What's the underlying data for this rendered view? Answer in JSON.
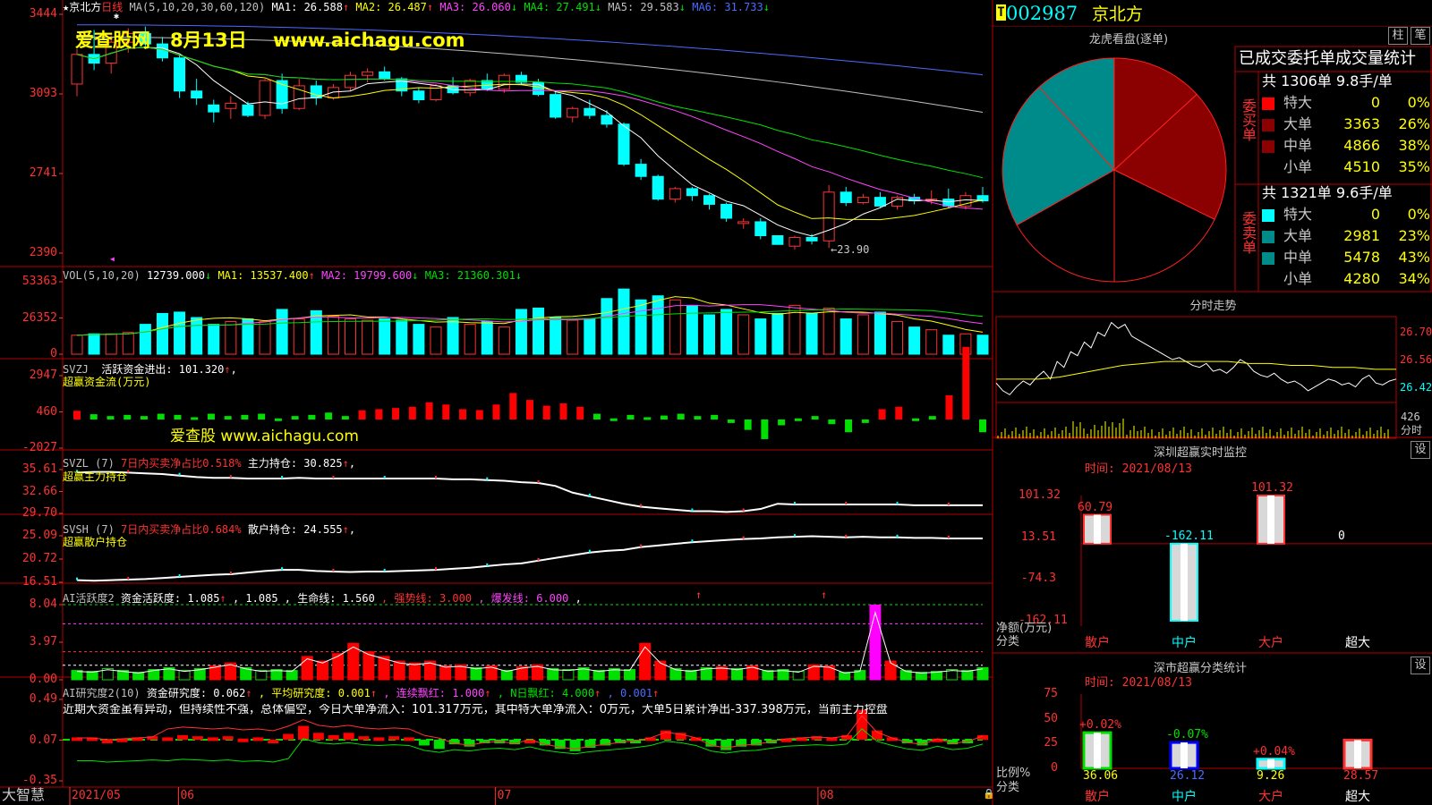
{
  "stock": {
    "code": "002987",
    "name": "京北方",
    "title_name": "京北方",
    "period": "日线",
    "t_badge": "T"
  },
  "ma_line": {
    "prefix": "MA(5,10,20,30,60,120)",
    "items": [
      {
        "label": "MA1: 26.588",
        "arrow": "↑",
        "color": "#ffffff"
      },
      {
        "label": "MA2: 26.487",
        "arrow": "↑",
        "color": "#ffff00"
      },
      {
        "label": "MA3: 26.060",
        "arrow": "↓",
        "color": "#ff44ff"
      },
      {
        "label": "MA4: 27.491",
        "arrow": "↓",
        "color": "#00e000"
      },
      {
        "label": "MA5: 29.583",
        "arrow": "↓",
        "color": "#c0c0c0"
      },
      {
        "label": "MA6: 31.733",
        "arrow": "↓",
        "color": "#4a6cff"
      }
    ]
  },
  "watermark": {
    "site": "爱查股网",
    "date": "8月13日",
    "url": "www.aichagu.com",
    "mid_site": "爱查股",
    "mid_url": "www.aichagu.com"
  },
  "price_axis": [
    "3444",
    "3093",
    "2741",
    "2390"
  ],
  "price_low_label": "←23.90",
  "candles": [
    [
      31.2,
      33.2,
      30.5,
      32.9
    ],
    [
      32.9,
      34.3,
      32.0,
      32.4
    ],
    [
      32.4,
      34.0,
      31.8,
      33.6
    ],
    [
      33.6,
      34.4,
      33.0,
      34.1
    ],
    [
      34.1,
      34.5,
      33.2,
      33.5
    ],
    [
      33.5,
      33.9,
      32.5,
      32.7
    ],
    [
      32.7,
      32.9,
      30.4,
      30.8
    ],
    [
      30.8,
      31.5,
      30.0,
      30.4
    ],
    [
      30.0,
      30.3,
      29.0,
      29.6
    ],
    [
      29.8,
      30.5,
      29.2,
      30.1
    ],
    [
      30.0,
      30.2,
      29.3,
      29.4
    ],
    [
      29.4,
      31.5,
      29.2,
      31.4
    ],
    [
      31.4,
      31.8,
      29.5,
      29.8
    ],
    [
      29.8,
      31.5,
      29.7,
      31.1
    ],
    [
      31.1,
      31.4,
      30.0,
      30.4
    ],
    [
      30.4,
      31.2,
      30.3,
      31.0
    ],
    [
      31.0,
      31.9,
      30.8,
      31.7
    ],
    [
      31.7,
      32.1,
      31.3,
      31.9
    ],
    [
      31.9,
      32.2,
      31.4,
      31.5
    ],
    [
      31.5,
      31.6,
      30.5,
      30.8
    ],
    [
      30.8,
      31.0,
      30.1,
      30.3
    ],
    [
      30.3,
      31.2,
      30.2,
      31.1
    ],
    [
      31.1,
      31.6,
      30.6,
      30.7
    ],
    [
      30.7,
      31.5,
      30.5,
      31.4
    ],
    [
      31.4,
      31.8,
      30.8,
      30.9
    ],
    [
      30.9,
      31.8,
      30.7,
      31.7
    ],
    [
      31.7,
      31.9,
      31.2,
      31.3
    ],
    [
      31.3,
      31.5,
      30.5,
      30.6
    ],
    [
      30.6,
      30.8,
      29.2,
      29.3
    ],
    [
      29.3,
      29.9,
      29.0,
      29.8
    ],
    [
      29.8,
      30.3,
      29.2,
      29.4
    ],
    [
      29.4,
      29.7,
      28.7,
      28.9
    ],
    [
      28.9,
      29.0,
      26.5,
      26.6
    ],
    [
      26.6,
      26.9,
      25.7,
      25.9
    ],
    [
      25.9,
      26.0,
      24.5,
      24.6
    ],
    [
      24.6,
      25.3,
      24.4,
      25.2
    ],
    [
      25.2,
      25.3,
      24.5,
      24.8
    ],
    [
      24.8,
      24.9,
      24.0,
      24.3
    ],
    [
      24.3,
      24.4,
      23.3,
      23.5
    ],
    [
      23.2,
      23.5,
      22.9,
      23.3
    ],
    [
      23.3,
      23.5,
      22.3,
      22.5
    ],
    [
      22.5,
      21.9,
      21.9,
      22.0
    ],
    [
      21.9,
      22.5,
      21.7,
      22.4
    ],
    [
      22.4,
      22.6,
      22.0,
      22.2
    ],
    [
      22.2,
      25.4,
      21.8,
      25.0
    ],
    [
      25.0,
      25.3,
      24.2,
      24.4
    ],
    [
      24.4,
      24.9,
      24.3,
      24.7
    ],
    [
      24.7,
      25.0,
      24.1,
      24.2
    ],
    [
      24.2,
      24.8,
      24.0,
      24.7
    ],
    [
      24.7,
      24.9,
      24.3,
      24.5
    ],
    [
      24.5,
      25.1,
      24.3,
      24.6
    ],
    [
      24.6,
      25.2,
      24.1,
      24.2
    ],
    [
      24.2,
      25.0,
      24.0,
      24.8
    ],
    [
      24.8,
      25.3,
      24.4,
      24.5
    ]
  ],
  "vol_line": {
    "prefix": "VOL(5,10,20)",
    "items": [
      {
        "label": "12739.000",
        "arrow": "↓",
        "color": "#ffffff"
      },
      {
        "label": "MA1: 13537.400",
        "arrow": "↑",
        "color": "#ffff00"
      },
      {
        "label": "MA2: 19799.600",
        "arrow": "↓",
        "color": "#ff44ff"
      },
      {
        "label": "MA3: 21360.301",
        "arrow": "↓",
        "color": "#00e000"
      }
    ],
    "axis": [
      "53363",
      "26352",
      "0"
    ]
  },
  "volumes": [
    14000,
    15000,
    15000,
    16000,
    22000,
    30000,
    31000,
    27000,
    22000,
    24000,
    26000,
    24000,
    33000,
    26000,
    32000,
    28000,
    26000,
    25000,
    26000,
    25000,
    22000,
    20000,
    27000,
    22000,
    24000,
    20000,
    33000,
    34000,
    27000,
    25000,
    26000,
    41000,
    48000,
    40000,
    43000,
    40000,
    36000,
    29000,
    33000,
    29000,
    26000,
    30000,
    36000,
    30000,
    34000,
    26000,
    29000,
    31000,
    24000,
    20000,
    18000,
    14000,
    15000,
    14000
  ],
  "svzj": {
    "prefix": "SVZJ",
    "label": "活跃资金进出: 101.320",
    "arrow": "↑",
    "sub": "超赢资金流(万元)",
    "axis": [
      "2947",
      "460",
      "-2027"
    ]
  },
  "svzj_vals": [
    30,
    -120,
    -200,
    -150,
    -200,
    -100,
    -150,
    -250,
    -100,
    -200,
    -150,
    -100,
    -300,
    -200,
    -150,
    -50,
    -200,
    50,
    100,
    150,
    200,
    400,
    300,
    100,
    60,
    300,
    800,
    500,
    250,
    350,
    200,
    -100,
    -300,
    -150,
    -250,
    -180,
    -100,
    -200,
    -150,
    -500,
    -800,
    -1200,
    -600,
    -300,
    -200,
    -550,
    -900,
    -500,
    100,
    200,
    -300,
    -200,
    700,
    2800,
    -900
  ],
  "svzl": {
    "prefix": "SVZL (7)",
    "ratio": "7日内买卖净占比0.518%",
    "hold": "主力持仓: 30.825",
    "arrow": "↑",
    "sub": "超赢主力持仓",
    "axis": [
      "35.61",
      "32.66",
      "29.70"
    ]
  },
  "svzl_vals": [
    35.2,
    35.3,
    35.3,
    35.2,
    35.1,
    35.0,
    34.8,
    34.6,
    34.5,
    34.5,
    34.4,
    34.4,
    34.4,
    34.5,
    34.4,
    34.4,
    34.4,
    34.4,
    34.4,
    34.4,
    34.4,
    34.4,
    34.3,
    34.3,
    34.2,
    34.1,
    33.9,
    33.8,
    33.4,
    32.5,
    32.0,
    31.5,
    31.0,
    30.6,
    30.4,
    30.2,
    30.0,
    30.0,
    29.9,
    30.0,
    30.3,
    31.0,
    30.9,
    30.9,
    30.9,
    30.9,
    30.9,
    30.9,
    30.9,
    30.8,
    30.8,
    30.8,
    30.8,
    30.8
  ],
  "svsh": {
    "prefix": "SVSH (7)",
    "ratio": "7日内买卖净占比0.684%",
    "hold": "散户持仓: 24.555",
    "arrow": "↑",
    "sub": "超赢散户持仓",
    "axis": [
      "25.09",
      "20.72",
      "16.51"
    ]
  },
  "svsh_vals": [
    16.9,
    16.8,
    16.9,
    17.0,
    17.1,
    17.3,
    17.5,
    17.7,
    17.9,
    18.0,
    18.3,
    18.6,
    18.8,
    18.8,
    18.6,
    18.5,
    18.4,
    18.5,
    18.5,
    18.6,
    18.7,
    18.8,
    19.0,
    19.2,
    19.5,
    19.8,
    20.0,
    20.5,
    21.0,
    21.5,
    22.0,
    22.3,
    22.5,
    23.0,
    23.3,
    23.6,
    23.9,
    24.1,
    24.3,
    24.5,
    24.6,
    24.8,
    24.9,
    25.0,
    24.9,
    24.8,
    24.9,
    24.8,
    24.8,
    24.7,
    24.7,
    24.6,
    24.6,
    24.6
  ],
  "ai_active": {
    "prefix": "AI活跃度2",
    "items": [
      {
        "label": "资金活跃度: 1.085",
        "arrow": "↑",
        "color": "#ffffff"
      },
      {
        "label": ", 1.085",
        "arrow": "",
        "color": "#ffffff"
      },
      {
        "label": ", 生命线: 1.560",
        "arrow": "",
        "color": "#ffffff"
      },
      {
        "label": ", 强势线: 3.000",
        "arrow": "",
        "color": "#ff3232"
      },
      {
        "label": ", 爆发线: 6.000",
        "arrow": "",
        "color": "#ff44ff"
      },
      {
        "label": ",",
        "arrow": "",
        "color": "#ffffff"
      }
    ],
    "axis": [
      "8.04",
      "3.97",
      "0.00"
    ]
  },
  "ai_active_vals": [
    1.0,
    0.9,
    1.2,
    1.0,
    0.8,
    1.1,
    1.3,
    1.0,
    1.2,
    1.5,
    1.8,
    1.3,
    1.0,
    1.1,
    1.0,
    2.5,
    2.0,
    2.8,
    3.9,
    3.0,
    2.5,
    2.0,
    1.8,
    2.0,
    1.5,
    1.6,
    1.3,
    1.5,
    1.0,
    1.4,
    1.6,
    1.2,
    1.1,
    1.3,
    1.0,
    1.2,
    1.1,
    3.9,
    2.0,
    1.2,
    1.0,
    1.3,
    1.4,
    1.2,
    1.5,
    1.0,
    1.1,
    0.9,
    1.6,
    1.5,
    0.8,
    1.0,
    8.0,
    2.0,
    1.0,
    0.8,
    0.9,
    1.1,
    1.0,
    1.3
  ],
  "ai_research": {
    "prefix": "AI研究度2(10)",
    "items": [
      {
        "label": "资金研究度: 0.062",
        "arrow": "↑",
        "color": "#ffffff"
      },
      {
        "label": ", 平均研究度: 0.001",
        "arrow": "↑",
        "color": "#ffff00"
      },
      {
        "label": ", 连续飘红: 1.000",
        "arrow": "↑",
        "color": "#ff44ff"
      },
      {
        "label": ", N日飘红: 4.000",
        "arrow": "↑",
        "color": "#00e000"
      },
      {
        "label": ", 0.001",
        "arrow": "↑",
        "color": "#4a6cff"
      }
    ],
    "comment": "近期大资金虽有异动，但持续性不强，总体偏空，今日大单净流入：101.317万元，其中特大单净流入：0万元，大单5日累计净出-337.398万元，当前主力控盘",
    "axis": [
      "0.49",
      "0.07",
      "-0.35"
    ]
  },
  "ai_research_vals": [
    0.02,
    0.02,
    0.0,
    0.01,
    0.02,
    0.03,
    0.02,
    0.04,
    0.03,
    0.02,
    0.03,
    0.01,
    0.02,
    0.0,
    0.05,
    0.12,
    0.06,
    0.04,
    0.06,
    0.03,
    0.02,
    0.03,
    0.02,
    -0.05,
    -0.08,
    -0.04,
    -0.06,
    -0.03,
    -0.02,
    -0.04,
    0.0,
    -0.05,
    -0.08,
    -0.1,
    -0.07,
    -0.05,
    -0.03,
    -0.01,
    0.02,
    0.08,
    0.06,
    0.02,
    -0.06,
    -0.09,
    -0.06,
    -0.05,
    -0.02,
    0.01,
    0.02,
    0.03,
    0.02,
    0.04,
    0.26,
    0.08,
    0.02,
    -0.03,
    -0.05,
    0.01,
    -0.04,
    -0.02,
    0.04
  ],
  "date_axis": [
    {
      "label": "2021/05",
      "frac": 0.0
    },
    {
      "label": "06",
      "frac": 0.12
    },
    {
      "label": "07",
      "frac": 0.47
    },
    {
      "label": "08",
      "frac": 0.826
    }
  ],
  "footer_brand": "大智慧",
  "lhkp": {
    "title": "龙虎看盘(逐单)",
    "btn_zhu": "柱",
    "btn_bi": "笔",
    "stat_title": "已成交委托单成交量统计",
    "buy_label": "委买单",
    "sell_label": "委卖单",
    "buy_total": "共 1306单 9.8手/单",
    "sell_total": "共 1321单 9.6手/单",
    "buy_rows": [
      {
        "name": "特大",
        "value": "0",
        "pct": "0%",
        "color": "#ff0000"
      },
      {
        "name": "大单",
        "value": "3363",
        "pct": "26%",
        "color": "#8b0000"
      },
      {
        "name": "中单",
        "value": "4866",
        "pct": "38%",
        "color": "#8b0000"
      },
      {
        "name": "小单",
        "value": "4510",
        "pct": "35%",
        "color": "#000000"
      }
    ],
    "sell_rows": [
      {
        "name": "特大",
        "value": "0",
        "pct": "0%",
        "color": "#00ffff"
      },
      {
        "name": "大单",
        "value": "2981",
        "pct": "23%",
        "color": "#008b8b"
      },
      {
        "name": "中单",
        "value": "5478",
        "pct": "43%",
        "color": "#008b8b"
      },
      {
        "name": "小单",
        "value": "4280",
        "pct": "34%",
        "color": "#000000"
      }
    ]
  },
  "intraday": {
    "title": "分时走势",
    "axis": [
      "26.70",
      "26.56",
      "26.42"
    ],
    "vol_label": "426",
    "footer": "分时",
    "prices": [
      26.44,
      26.4,
      26.38,
      26.42,
      26.45,
      26.43,
      26.47,
      26.5,
      26.46,
      26.55,
      26.52,
      26.6,
      26.58,
      26.65,
      26.62,
      26.7,
      26.68,
      26.75,
      26.72,
      26.74,
      26.68,
      26.66,
      26.64,
      26.62,
      26.6,
      26.58,
      26.56,
      26.57,
      26.55,
      26.53,
      26.52,
      26.54,
      26.5,
      26.51,
      26.49,
      26.52,
      26.56,
      26.54,
      26.5,
      26.48,
      26.47,
      26.49,
      26.46,
      26.44,
      26.45,
      26.43,
      26.4,
      26.42,
      26.44,
      26.46,
      26.45,
      26.43,
      26.44,
      26.42,
      26.46,
      26.48,
      26.44,
      26.43,
      26.45,
      26.46
    ],
    "avg": [
      26.46,
      26.46,
      26.46,
      26.47,
      26.49,
      26.51,
      26.53,
      26.54,
      26.55,
      26.55,
      26.55,
      26.55,
      26.54,
      26.54,
      26.53,
      26.53,
      26.52,
      26.52,
      26.51,
      26.51
    ]
  },
  "sz_monitor": {
    "title": "深圳超赢实时监控",
    "btn": "设",
    "time_label": "时间: 2021/08/13",
    "axis": [
      "101.32",
      "13.51",
      "-74.3",
      "-162.11"
    ],
    "y_unit": "净额(万元)",
    "x_unit": "分类",
    "cats": [
      "散户",
      "中户",
      "大户",
      "超大"
    ],
    "values": [
      60.79,
      -162.11,
      101.32,
      0
    ],
    "value_labels": [
      "60.79",
      "-162.11",
      "101.32",
      "0"
    ],
    "ymax": 101.32,
    "ymin": -162.11,
    "fills": [
      "#ff3232",
      "#00ffff",
      "#ff3232",
      "#ff3232"
    ]
  },
  "sz_class": {
    "title": "深市超赢分类统计",
    "btn": "设",
    "time_label": "时间: 2021/08/13",
    "axis": [
      "75",
      "50",
      "25",
      "0"
    ],
    "y_unit": "比例%",
    "x_unit": "分类",
    "cats": [
      "散户",
      "中户",
      "大户",
      "超大"
    ],
    "values": [
      36.06,
      26.12,
      9.26,
      28.57
    ],
    "value_labels": [
      "36.06",
      "26.12",
      "9.26",
      "28.57"
    ],
    "delta_labels": [
      "+0.02%",
      "-0.07%",
      "+0.04%",
      ""
    ],
    "ymax": 75,
    "fills": [
      "#00e000",
      "#0000ff",
      "#00ffff",
      "#ff3232"
    ]
  }
}
